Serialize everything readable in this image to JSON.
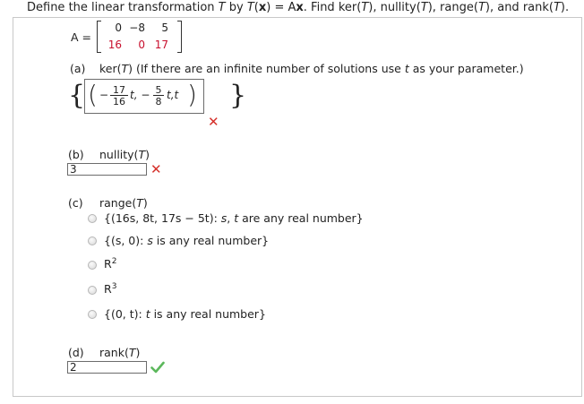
{
  "header": {
    "p1": "Define the linear transformation ",
    "T1": "T",
    "p2": " by ",
    "T2": "T",
    "p3": "(",
    "x": "x",
    "p4": ") = A",
    "x2": "x",
    "p5": ". Find ker(",
    "T3": "T",
    "p6": "), nullity(",
    "T4": "T",
    "p7": "), range(",
    "T5": "T",
    "p8": "), and rank(",
    "T6": "T",
    "p9": ")."
  },
  "matrix": {
    "label": "A =",
    "row1": [
      "0",
      "−8",
      "5"
    ],
    "row2": [
      "16",
      "0",
      "17"
    ]
  },
  "part_a": {
    "label": "(a)",
    "q1": "ker(",
    "T": "T",
    "q2": ") (If there are an infinite number of solutions use ",
    "t": "t",
    "q3": " as your parameter.)",
    "answer": {
      "open_brace": "{",
      "close_brace": "}",
      "paren_open": "(",
      "paren_close": ")",
      "neg1": "−",
      "frac1_num": "17",
      "frac1_den": "16",
      "after1": "t, −",
      "frac2_num": "5",
      "frac2_den": "8",
      "after2": "t,t"
    },
    "status": "incorrect"
  },
  "part_b": {
    "label": "(b)",
    "q1": "nullity(",
    "T": "T",
    "q2": ")",
    "answer": "3",
    "status": "incorrect"
  },
  "part_c": {
    "label": "(c)",
    "q1": "range(",
    "T": "T",
    "q2": ")",
    "options": [
      {
        "a": "{(16s, 8t, 17s − 5t): ",
        "b": "s",
        "c": ", ",
        "d": "t",
        "e": " are any real number}"
      },
      {
        "a": "{(s, 0): ",
        "b": "s",
        "c": " is any real number}",
        "d": "",
        "e": ""
      },
      {
        "a": "R",
        "sup": "2"
      },
      {
        "a": "R",
        "sup": "3"
      },
      {
        "a": "{(0, t): ",
        "b": "t",
        "c": " is any real number}",
        "d": "",
        "e": ""
      }
    ]
  },
  "part_d": {
    "label": "(d)",
    "q1": "rank(",
    "T": "T",
    "q2": ")",
    "answer": "2",
    "status": "correct"
  },
  "colors": {
    "incorrect": "#d5312b",
    "correct": "#5cb85c",
    "matrix_row2": "#c8102e"
  },
  "icons": {
    "incorrect": "x-mark-icon",
    "correct": "check-mark-icon"
  }
}
